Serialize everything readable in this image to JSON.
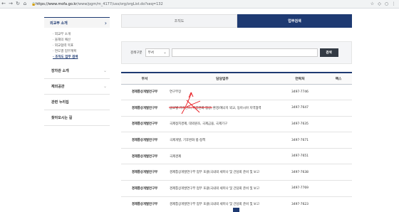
{
  "browser": {
    "back": "←",
    "forward": "→",
    "reload": "↻",
    "home": "⌂",
    "url_host": "https://www.mofa.go.kr",
    "url_path": "/www/pgm/m_4177/uss/org/orgList.do?seq=132",
    "icons": [
      "star-icon",
      "extension-icon",
      "profile-icon",
      "menu-icon"
    ]
  },
  "sidebar": {
    "active_label": "외교부 소개",
    "sub_items": [
      {
        "label": "· 외교부 소개",
        "current": false
      },
      {
        "label": "· 올해의 예산",
        "current": false
      },
      {
        "label": "· 외교협력 목표",
        "current": false
      },
      {
        "label": "· 연도별 업무계획",
        "current": false
      },
      {
        "label": "· 조직도 업무 검색",
        "current": true
      }
    ],
    "items": [
      {
        "label": "장차관 소개"
      },
      {
        "label": "재외공관"
      },
      {
        "label": "관련 누리집"
      },
      {
        "label": "찾아오시는 길"
      }
    ]
  },
  "tabs": [
    {
      "label": "조직도",
      "active": false
    },
    {
      "label": "업무검색",
      "active": true
    }
  ],
  "search": {
    "label": "검색구분",
    "select_value": "부서",
    "input_value": "",
    "button_label": "검색"
  },
  "table": {
    "headers": [
      "부서",
      "담당업무",
      "연락처",
      "팩스"
    ],
    "rows": [
      {
        "dept": "경제통상개발연구부",
        "duty": "연구부장",
        "tel": "3497-7746",
        "fax": ""
      },
      {
        "dept": "경제통상개발연구부",
        "duty": "글로벌 거버넌스, 기후변화 협상, 환경/에너지 외교, 동아시아 지역협력",
        "tel": "3497-7647",
        "fax": ""
      },
      {
        "dept": "경제통상개발연구부",
        "duty": "국제정치경제, 대외원조, 국제금융, 국제기구",
        "tel": "3497-7635",
        "fax": ""
      },
      {
        "dept": "경제통상개발연구부",
        "duty": "국제개발, 기후변화 법·정책",
        "tel": "3497-7671",
        "fax": ""
      },
      {
        "dept": "경제통상개발연구부",
        "duty": "국제경제",
        "tel": "3497-7651",
        "fax": ""
      },
      {
        "dept": "경제통상개발연구부",
        "duty": "경제통상개발연구부 업무 포괄(국내외 세미나 및 간담회 준비 및 보고",
        "tel": "3497-7638",
        "fax": ""
      },
      {
        "dept": "경제통상개발연구부",
        "duty": "경제통상개발연구부 업무 포괄(국내외 세미나 및 간담회 준비 및 보고",
        "tel": "3497-7769",
        "fax": ""
      },
      {
        "dept": "경제통상개발연구부",
        "duty": "경제통상개발연구부 업무 포괄(국내외 세미나 및 간담회 준비 및 보고",
        "tel": "3497-7623",
        "fax": ""
      }
    ]
  },
  "colors": {
    "navy": "#1e3a72",
    "annotation_red": "#e8151b"
  }
}
